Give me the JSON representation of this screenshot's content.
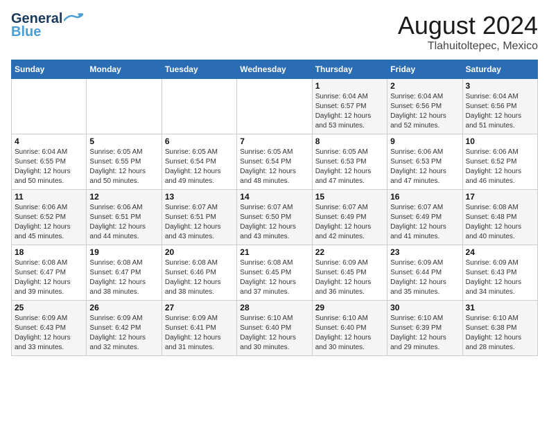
{
  "header": {
    "logo_general": "General",
    "logo_blue": "Blue",
    "calendar_title": "August 2024",
    "calendar_subtitle": "Tlahuitoltepec, Mexico"
  },
  "weekdays": [
    "Sunday",
    "Monday",
    "Tuesday",
    "Wednesday",
    "Thursday",
    "Friday",
    "Saturday"
  ],
  "weeks": [
    [
      {
        "day": "",
        "info": ""
      },
      {
        "day": "",
        "info": ""
      },
      {
        "day": "",
        "info": ""
      },
      {
        "day": "",
        "info": ""
      },
      {
        "day": "1",
        "info": "Sunrise: 6:04 AM\nSunset: 6:57 PM\nDaylight: 12 hours\nand 53 minutes."
      },
      {
        "day": "2",
        "info": "Sunrise: 6:04 AM\nSunset: 6:56 PM\nDaylight: 12 hours\nand 52 minutes."
      },
      {
        "day": "3",
        "info": "Sunrise: 6:04 AM\nSunset: 6:56 PM\nDaylight: 12 hours\nand 51 minutes."
      }
    ],
    [
      {
        "day": "4",
        "info": "Sunrise: 6:04 AM\nSunset: 6:55 PM\nDaylight: 12 hours\nand 50 minutes."
      },
      {
        "day": "5",
        "info": "Sunrise: 6:05 AM\nSunset: 6:55 PM\nDaylight: 12 hours\nand 50 minutes."
      },
      {
        "day": "6",
        "info": "Sunrise: 6:05 AM\nSunset: 6:54 PM\nDaylight: 12 hours\nand 49 minutes."
      },
      {
        "day": "7",
        "info": "Sunrise: 6:05 AM\nSunset: 6:54 PM\nDaylight: 12 hours\nand 48 minutes."
      },
      {
        "day": "8",
        "info": "Sunrise: 6:05 AM\nSunset: 6:53 PM\nDaylight: 12 hours\nand 47 minutes."
      },
      {
        "day": "9",
        "info": "Sunrise: 6:06 AM\nSunset: 6:53 PM\nDaylight: 12 hours\nand 47 minutes."
      },
      {
        "day": "10",
        "info": "Sunrise: 6:06 AM\nSunset: 6:52 PM\nDaylight: 12 hours\nand 46 minutes."
      }
    ],
    [
      {
        "day": "11",
        "info": "Sunrise: 6:06 AM\nSunset: 6:52 PM\nDaylight: 12 hours\nand 45 minutes."
      },
      {
        "day": "12",
        "info": "Sunrise: 6:06 AM\nSunset: 6:51 PM\nDaylight: 12 hours\nand 44 minutes."
      },
      {
        "day": "13",
        "info": "Sunrise: 6:07 AM\nSunset: 6:51 PM\nDaylight: 12 hours\nand 43 minutes."
      },
      {
        "day": "14",
        "info": "Sunrise: 6:07 AM\nSunset: 6:50 PM\nDaylight: 12 hours\nand 43 minutes."
      },
      {
        "day": "15",
        "info": "Sunrise: 6:07 AM\nSunset: 6:49 PM\nDaylight: 12 hours\nand 42 minutes."
      },
      {
        "day": "16",
        "info": "Sunrise: 6:07 AM\nSunset: 6:49 PM\nDaylight: 12 hours\nand 41 minutes."
      },
      {
        "day": "17",
        "info": "Sunrise: 6:08 AM\nSunset: 6:48 PM\nDaylight: 12 hours\nand 40 minutes."
      }
    ],
    [
      {
        "day": "18",
        "info": "Sunrise: 6:08 AM\nSunset: 6:47 PM\nDaylight: 12 hours\nand 39 minutes."
      },
      {
        "day": "19",
        "info": "Sunrise: 6:08 AM\nSunset: 6:47 PM\nDaylight: 12 hours\nand 38 minutes."
      },
      {
        "day": "20",
        "info": "Sunrise: 6:08 AM\nSunset: 6:46 PM\nDaylight: 12 hours\nand 38 minutes."
      },
      {
        "day": "21",
        "info": "Sunrise: 6:08 AM\nSunset: 6:45 PM\nDaylight: 12 hours\nand 37 minutes."
      },
      {
        "day": "22",
        "info": "Sunrise: 6:09 AM\nSunset: 6:45 PM\nDaylight: 12 hours\nand 36 minutes."
      },
      {
        "day": "23",
        "info": "Sunrise: 6:09 AM\nSunset: 6:44 PM\nDaylight: 12 hours\nand 35 minutes."
      },
      {
        "day": "24",
        "info": "Sunrise: 6:09 AM\nSunset: 6:43 PM\nDaylight: 12 hours\nand 34 minutes."
      }
    ],
    [
      {
        "day": "25",
        "info": "Sunrise: 6:09 AM\nSunset: 6:43 PM\nDaylight: 12 hours\nand 33 minutes."
      },
      {
        "day": "26",
        "info": "Sunrise: 6:09 AM\nSunset: 6:42 PM\nDaylight: 12 hours\nand 32 minutes."
      },
      {
        "day": "27",
        "info": "Sunrise: 6:09 AM\nSunset: 6:41 PM\nDaylight: 12 hours\nand 31 minutes."
      },
      {
        "day": "28",
        "info": "Sunrise: 6:10 AM\nSunset: 6:40 PM\nDaylight: 12 hours\nand 30 minutes."
      },
      {
        "day": "29",
        "info": "Sunrise: 6:10 AM\nSunset: 6:40 PM\nDaylight: 12 hours\nand 30 minutes."
      },
      {
        "day": "30",
        "info": "Sunrise: 6:10 AM\nSunset: 6:39 PM\nDaylight: 12 hours\nand 29 minutes."
      },
      {
        "day": "31",
        "info": "Sunrise: 6:10 AM\nSunset: 6:38 PM\nDaylight: 12 hours\nand 28 minutes."
      }
    ]
  ]
}
